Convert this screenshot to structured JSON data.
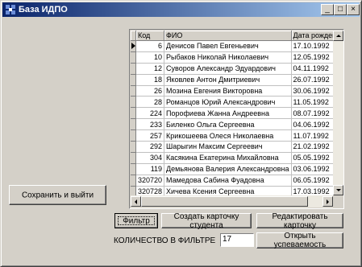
{
  "window": {
    "title": "База ИДПО"
  },
  "title_buttons": {
    "minimize": "_",
    "maximize": "□",
    "close": "×"
  },
  "grid": {
    "columns": [
      "Код",
      "ФИО",
      "Дата рождения"
    ],
    "rows": [
      {
        "code": "6",
        "name": "Денисов Павел Евгеньевич",
        "dob": "17.10.1992"
      },
      {
        "code": "10",
        "name": "Рыбаков Николай Николаевич",
        "dob": "12.05.1992"
      },
      {
        "code": "12",
        "name": "Суворов Александр Эдуардович",
        "dob": "04.11.1992"
      },
      {
        "code": "18",
        "name": "Яковлев Антон Дмитриевич",
        "dob": "26.07.1992"
      },
      {
        "code": "26",
        "name": "Мозина Евгения Викторовна",
        "dob": "30.06.1992"
      },
      {
        "code": "28",
        "name": "Романцов Юрий Александрович",
        "dob": "11.05.1992"
      },
      {
        "code": "224",
        "name": "Порофиева Жанна Андреевна",
        "dob": "08.07.1992"
      },
      {
        "code": "233",
        "name": "Биленко Ольга Сергеевна",
        "dob": "04.06.1992"
      },
      {
        "code": "257",
        "name": "Крикошеева Олеся Николаевна",
        "dob": "11.07.1992"
      },
      {
        "code": "292",
        "name": "Шарыгин Максим Сергеевич",
        "dob": "21.02.1992"
      },
      {
        "code": "304",
        "name": "Касякина Екатерина Михайловна",
        "dob": "05.05.1992"
      },
      {
        "code": "119",
        "name": "Демьянова Валерия Александровна",
        "dob": "03.06.1992"
      },
      {
        "code": "320720",
        "name": "Мамедова Сабина Фуадовна",
        "dob": "06.05.1992"
      },
      {
        "code": "320728",
        "name": "Хичева Ксения Сергеевна",
        "dob": "17.03.1992"
      }
    ]
  },
  "buttons": {
    "save_exit": "Сохранить и выйти",
    "filter": "Фильтр",
    "create_card": "Создать карточку студента",
    "edit_card": "Редактировать карточку",
    "open_progress": "Открыть успеваемость"
  },
  "filter_count": {
    "label": "КОЛИЧЕСТВО В ФИЛЬТРЕ",
    "value": "17"
  }
}
